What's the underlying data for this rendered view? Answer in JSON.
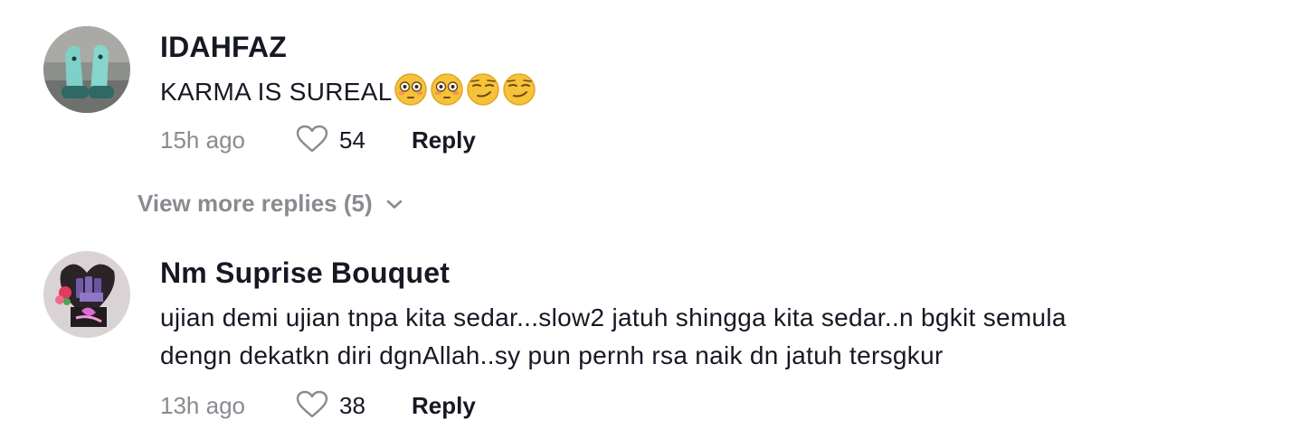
{
  "comments": [
    {
      "username": "IDAHFAZ",
      "text": "KARMA IS SUREAL",
      "emojis": [
        "flushed-face",
        "flushed-face",
        "smirking-face",
        "smirking-face"
      ],
      "time": "15h ago",
      "likes": "54",
      "reply_label": "Reply"
    },
    {
      "username": "Nm Suprise Bouquet",
      "text_line1": "ujian demi ujian tnpa kita sedar...slow2 jatuh shingga kita sedar..n bgkit semula",
      "text_line2": "dengn dekatkn diri dgnAllah..sy pun pernh rsa naik dn jatuh tersgkur",
      "time": "13h ago",
      "likes": "38",
      "reply_label": "Reply"
    }
  ],
  "view_more": {
    "label": "View more replies (5)",
    "icon": "chevron-down-icon"
  },
  "colors": {
    "primary_text": "#161823",
    "secondary_text": "#8a8b91"
  }
}
